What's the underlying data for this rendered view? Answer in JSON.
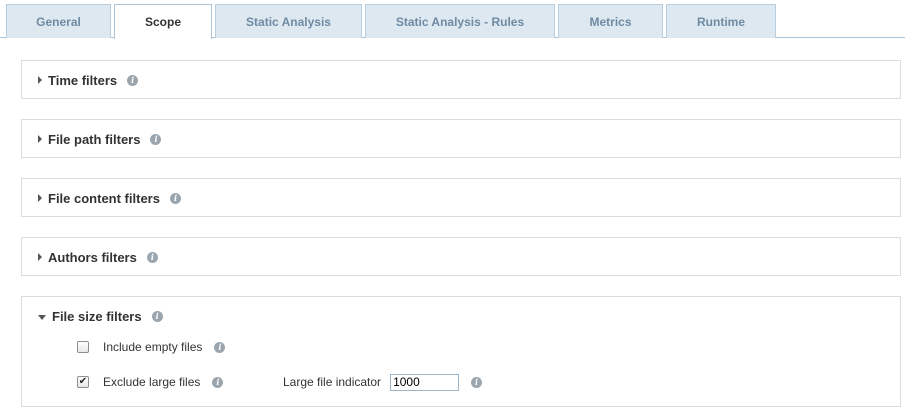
{
  "tabs": [
    {
      "label": "General",
      "active": false
    },
    {
      "label": "Scope",
      "active": true
    },
    {
      "label": "Static Analysis",
      "active": false
    },
    {
      "label": "Static Analysis - Rules",
      "active": false
    },
    {
      "label": "Metrics",
      "active": false
    },
    {
      "label": "Runtime",
      "active": false
    }
  ],
  "panels": [
    {
      "title": "Time filters",
      "expanded": false
    },
    {
      "title": "File path filters",
      "expanded": false
    },
    {
      "title": "File content filters",
      "expanded": false
    },
    {
      "title": "Authors filters",
      "expanded": false
    },
    {
      "title": "File size filters",
      "expanded": true
    }
  ],
  "file_size": {
    "include_empty": {
      "label": "Include empty files",
      "checked": false
    },
    "exclude_large": {
      "label": "Exclude large files",
      "checked": true
    },
    "large_indicator": {
      "label": "Large file indicator",
      "value": "1000"
    }
  },
  "info_icon_glyph": "i",
  "check_glyph": "✔",
  "colors": {
    "tab_bg": "#dde8f1",
    "tab_text": "#6f8ba3",
    "tab_border": "#a9c3d9",
    "panel_border": "#dcdcdc",
    "info_icon": "#9aa5ae"
  }
}
